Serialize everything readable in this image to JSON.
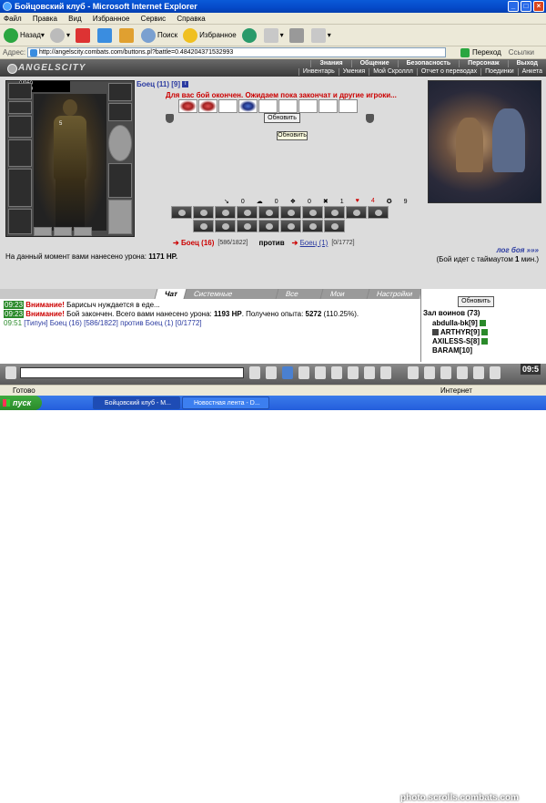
{
  "window": {
    "title": "Бойцовский клуб - Microsoft Internet Explorer"
  },
  "menu": [
    "Файл",
    "Правка",
    "Вид",
    "Избранное",
    "Сервис",
    "Справка"
  ],
  "toolbar": {
    "back": "Назад",
    "search": "Поиск",
    "favorites": "Избранное"
  },
  "address": {
    "label": "Адрес:",
    "url": "http://angelscity.combats.com/buttons.pl?battle=0.484204371532993",
    "go": "Переход",
    "links": "Ссылки"
  },
  "site": {
    "logo": "ANGELSCITY",
    "nav_top": [
      "Знания",
      "Общение",
      "Безопасность",
      "Персонаж",
      "Выход"
    ],
    "nav_sub": [
      "Инвентарь",
      "Умения",
      "Мой Скроллл",
      "Отчет о переводах",
      "Поединки",
      "Анкета"
    ]
  },
  "char": {
    "hp": "0/960",
    "mp": "0/960",
    "level": "5"
  },
  "opponent": {
    "name": "Боец (11) [9]",
    "info": "i"
  },
  "battle_message": "Для вас бой окончен. Ожидаем пока закончат и другие игроки...",
  "refresh_button": "Обновить",
  "tooltip": "Обновить",
  "counts": [
    {
      "icon": "↘",
      "value": "0"
    },
    {
      "icon": "☁",
      "value": "0"
    },
    {
      "icon": "❖",
      "value": "0"
    },
    {
      "icon": "✖",
      "value": "1"
    },
    {
      "icon": "♥",
      "value": "4",
      "red": true
    },
    {
      "icon": "✪",
      "value": "9"
    }
  ],
  "versus": {
    "left_name": "Боец (16)",
    "left_hp": "[586/1822]",
    "vs": "против",
    "right_name": "Боец (1)",
    "right_hp": "[0/1772]"
  },
  "damage": {
    "label": "На данный момент вами нанесено урона:",
    "value": "1171 HP."
  },
  "battle_log": {
    "link": "лог боя »»»",
    "text_a": "(Бой идет с таймаутом ",
    "timeout": "1",
    "text_b": " мин.)"
  },
  "chat": {
    "tabs": [
      "Чат",
      "Системные сообщения",
      "Все логи",
      "Мои логи",
      "Настройки"
    ],
    "lines": [
      {
        "time": "09:23",
        "label": "Внимание!",
        "text": " Барисыч нуждается в еде..."
      },
      {
        "time": "09:23",
        "label": "Внимание!",
        "text": " Бой закончен. Всего вами нанесено урона: ",
        "bold1": "1193 HP",
        "mid": ". Получено опыта: ",
        "bold2": "5272",
        "tail": " (110.25%)."
      },
      {
        "time": "09:51",
        "prefix": "[Типун]",
        "rest": " Боец (16) [586/1822] против Боец (1) [0/1772]"
      }
    ]
  },
  "room": {
    "refresh": "Обновить",
    "title": "Зал воинов (73)",
    "users": [
      "abdulla-bk[9]",
      "ARTHYR[9]",
      "AXILESS-S[8]",
      "BARAM[10]"
    ]
  },
  "clock": "09:5",
  "statusbar": {
    "text": "Готово",
    "zone": "Интернет"
  },
  "taskbar": {
    "start": "пуск",
    "tasks": [
      "Бойцовский клуб - M...",
      "Новостная лента - D..."
    ]
  },
  "watermark": "photo.scrolls.combats.com"
}
